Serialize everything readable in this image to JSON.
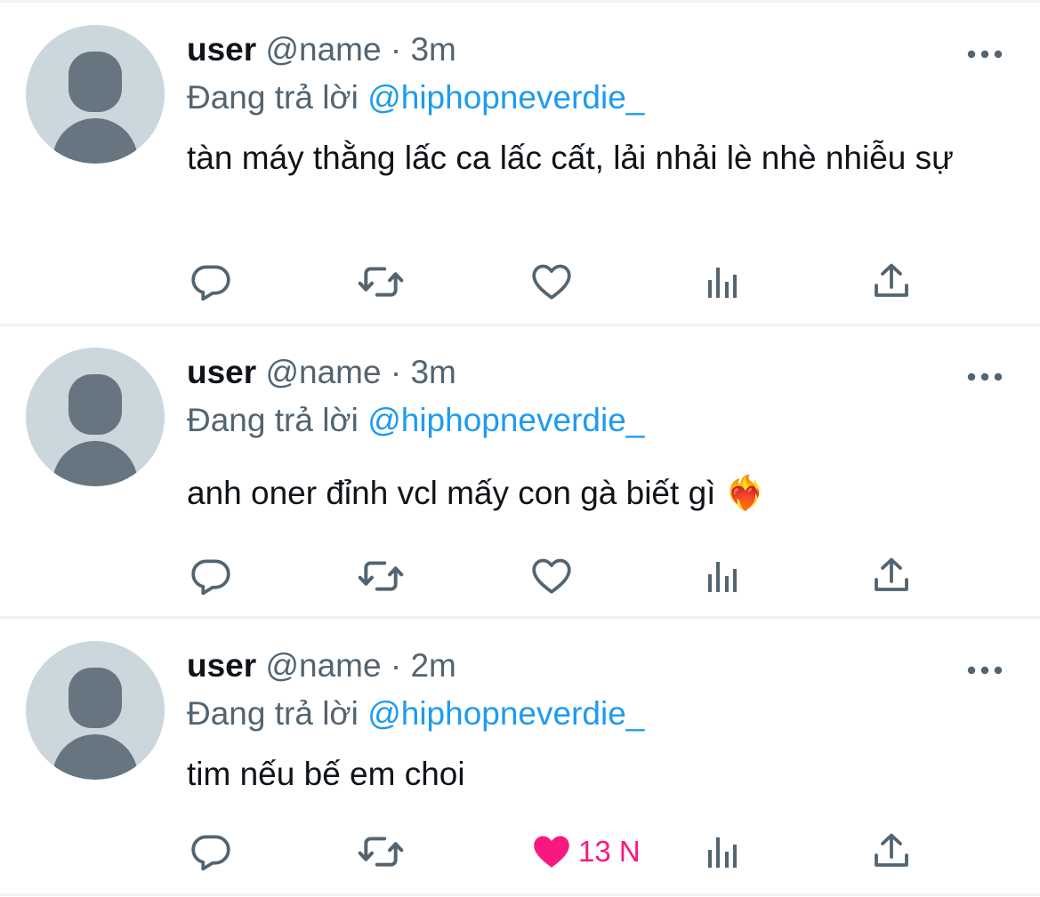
{
  "tweets": [
    {
      "display_name": "user",
      "handle": "@name",
      "separator": "·",
      "time": "3m",
      "reply_prefix": "Đang trả lời",
      "reply_to": "@hiphopneverdie_",
      "text": "tàn máy thằng lấc ca lấc cất, lải nhải lè nhè nhiễu sự",
      "liked": false,
      "like_count": ""
    },
    {
      "display_name": "user",
      "handle": "@name",
      "separator": "·",
      "time": "3m",
      "reply_prefix": "Đang trả lời",
      "reply_to": "@hiphopneverdie_",
      "text": "anh oner đỉnh vcl mấy con gà biết gì ❤️‍🔥",
      "liked": false,
      "like_count": ""
    },
    {
      "display_name": "user",
      "handle": "@name",
      "separator": "·",
      "time": "2m",
      "reply_prefix": "Đang trả lời",
      "reply_to": "@hiphopneverdie_",
      "text": "tim nếu bế em choi",
      "liked": true,
      "like_count": "13 N"
    }
  ],
  "icons": {
    "reply": "reply-icon",
    "retweet": "retweet-icon",
    "like": "heart-icon",
    "views": "views-icon",
    "share": "share-icon",
    "more": "more-icon"
  },
  "colors": {
    "text": "#0f1419",
    "secondary": "#536471",
    "mention": "#1d9bf0",
    "like_active": "#f91880",
    "icon": "#536471",
    "avatar_bg": "#ccd6dd",
    "avatar_fg": "#66757f",
    "separator": "#eff3f4"
  }
}
